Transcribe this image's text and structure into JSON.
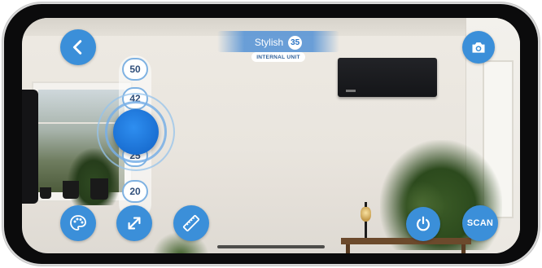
{
  "unit": {
    "name": "Stylish",
    "count": "35",
    "subtitle": "INTERNAL UNIT"
  },
  "slider": {
    "ticks": [
      "50",
      "42",
      "25",
      "20"
    ]
  },
  "buttons": {
    "scan_label": "SCAN"
  },
  "icons": {
    "back": "chevron-left-icon",
    "camera": "camera-icon",
    "palette": "palette-icon",
    "expand": "expand-arrows-icon",
    "ruler": "ruler-icon",
    "power": "power-icon"
  },
  "colors": {
    "accent": "#3b8fd9",
    "handle": "#1a6fd2",
    "banner": "#5b96d6"
  }
}
